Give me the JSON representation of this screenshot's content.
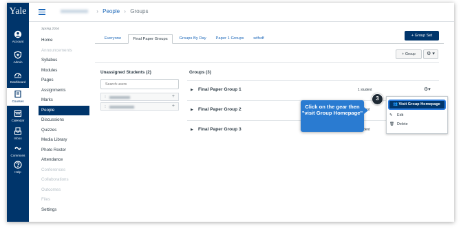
{
  "global_nav": {
    "brand": "Yale",
    "items": [
      {
        "label": "Account",
        "icon": "account-icon"
      },
      {
        "label": "Admin",
        "icon": "admin-shield-icon"
      },
      {
        "label": "Dashboard",
        "icon": "dashboard-icon"
      },
      {
        "label": "Courses",
        "icon": "courses-book-icon"
      },
      {
        "label": "Calendar",
        "icon": "calendar-icon"
      },
      {
        "label": "Inbox",
        "icon": "inbox-icon"
      },
      {
        "label": "Commons",
        "icon": "commons-icon"
      },
      {
        "label": "Help",
        "icon": "help-question-icon"
      }
    ]
  },
  "breadcrumb": {
    "course": "",
    "section": "People",
    "current": "Groups"
  },
  "course_nav": {
    "term": "Spring 2016",
    "links": [
      {
        "label": "Home",
        "state": "normal"
      },
      {
        "label": "Announcements",
        "state": "dim"
      },
      {
        "label": "Syllabus",
        "state": "normal"
      },
      {
        "label": "Modules",
        "state": "normal"
      },
      {
        "label": "Pages",
        "state": "normal"
      },
      {
        "label": "Assignments",
        "state": "normal"
      },
      {
        "label": "Marks",
        "state": "normal"
      },
      {
        "label": "People",
        "state": "active"
      },
      {
        "label": "Discussions",
        "state": "normal"
      },
      {
        "label": "Quizzes",
        "state": "normal"
      },
      {
        "label": "Media Library",
        "state": "normal"
      },
      {
        "label": "Photo Roster",
        "state": "normal"
      },
      {
        "label": "Attendance",
        "state": "normal"
      },
      {
        "label": "Conferences",
        "state": "dim"
      },
      {
        "label": "Collaborations",
        "state": "dim"
      },
      {
        "label": "Outcomes",
        "state": "dim"
      },
      {
        "label": "Files",
        "state": "dim"
      },
      {
        "label": "Settings",
        "state": "normal"
      }
    ]
  },
  "tabs": [
    {
      "label": "Everyone",
      "active": false
    },
    {
      "label": "Final Paper Groups",
      "active": true
    },
    {
      "label": "Groups By Day",
      "active": false
    },
    {
      "label": "Paper 1 Groups",
      "active": false
    },
    {
      "label": "sdfsdf",
      "active": false
    }
  ],
  "buttons": {
    "group_set": "+ Group Set",
    "group": "+ Group",
    "gear": "⚙ ▾"
  },
  "unassigned": {
    "title": "Unassigned Students (2)",
    "search_placeholder": "Search users",
    "students": [
      "",
      ""
    ]
  },
  "groups": {
    "title": "Groups (3)",
    "rows": [
      {
        "name": "Final Paper Group 1",
        "count": "1 student"
      },
      {
        "name": "Final Paper Group 2",
        "count": "udent"
      },
      {
        "name": "Final Paper Group 3",
        "count": "dent"
      }
    ]
  },
  "menu": {
    "visit": "Visit Group Homepage",
    "edit": "Edit",
    "delete": "Delete"
  },
  "annotation": {
    "step": "3",
    "callout": "Click on the gear then \"visit Group Homepage\""
  },
  "colors": {
    "brand": "#00356b",
    "link": "#1a66b8",
    "callout": "#2a7bd1"
  }
}
